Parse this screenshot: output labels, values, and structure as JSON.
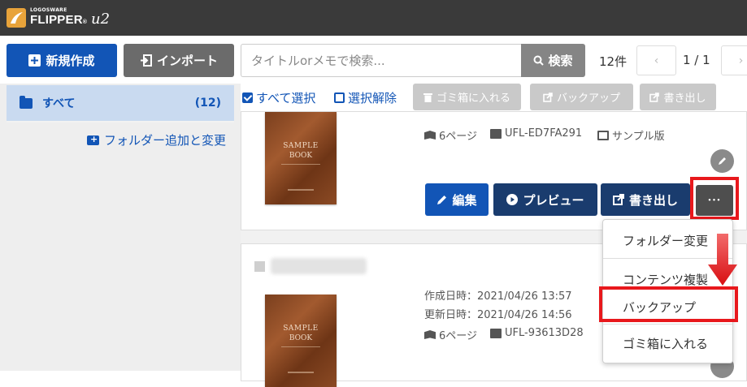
{
  "header": {
    "brand_small": "LOGOSWARE",
    "brand_main": "FLIPPER",
    "brand_reg": "®",
    "brand_version": "u2"
  },
  "actions": {
    "new_label": "新規作成",
    "import_label": "インポート",
    "search_placeholder": "タイトルorメモで検索...",
    "search_button": "検索",
    "count": "12件",
    "page": "1 / 1",
    "prev": "‹",
    "next": "›"
  },
  "sidebar": {
    "all_label": "すべて",
    "all_count": "(12)",
    "folder_add": "フォルダー追加と変更"
  },
  "toolbar": {
    "select_all": "すべて選択",
    "deselect": "選択解除",
    "trash": "ゴミ箱に入れる",
    "backup": "バックアップ",
    "export": "書き出し"
  },
  "cards": [
    {
      "pages": "6ページ",
      "id": "UFL-ED7FA291",
      "template": "サンプル版",
      "cover_line1": "SAMPLE",
      "cover_line2": "BOOK"
    },
    {
      "created": "作成日時：2021/04/26 13:57",
      "updated": "更新日時：2021/04/26 14:56",
      "pages": "6ページ",
      "id": "UFL-93613D28",
      "cover_line1": "SAMPLE",
      "cover_line2": "BOOK"
    }
  ],
  "card_actions": {
    "edit": "編集",
    "preview": "プレビュー",
    "export": "書き出し",
    "more": "•••"
  },
  "menu": {
    "items": [
      "フォルダー変更",
      "コンテンツ複製",
      "バックアップ",
      "ゴミ箱に入れる"
    ]
  },
  "colors": {
    "primary": "#1255b6",
    "dark_navy": "#1a3c6e",
    "highlight": "#e8181c",
    "topbar": "#3a3a3a"
  }
}
